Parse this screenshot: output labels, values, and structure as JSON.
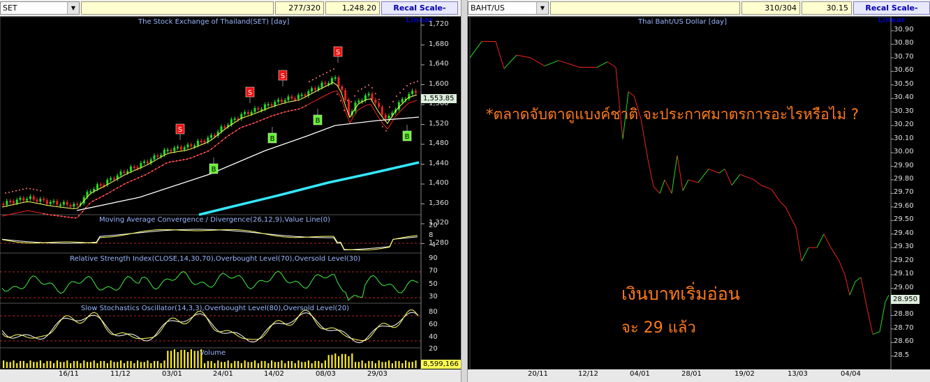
{
  "left": {
    "symbol": "SET",
    "bar_count": "277/320",
    "last_price": "1,248.20",
    "recal_label": "Recal Scale-Linear",
    "chart_title": "The Stock Exchange of Thailand(SET) [day]",
    "price_axis": [
      "1,720",
      "1,680",
      "1,640",
      "1,600",
      "1,560",
      "1,520",
      "1,480",
      "1,440",
      "1,400",
      "1,360",
      "1,320",
      "1,280"
    ],
    "current_price_label": "1,553.85",
    "macd_title": "Moving Average Convergence / Divergence(26,12,9),Value Line(0)",
    "macd_axis": [
      "20",
      "8",
      "-4"
    ],
    "rsi_title": "Relative Strength Index(CLOSE,14,30,70),Overbought Level(70),Oversold Level(30)",
    "rsi_axis": [
      "90",
      "70",
      "50",
      "30"
    ],
    "stoch_title": "Slow Stochastics Oscillator(14,3,3),Overbought Level(80),Oversold Level(20)",
    "stoch_axis": [
      "80",
      "60",
      "40",
      "20"
    ],
    "volume_title": "Volume",
    "volume_label": "8,599,166",
    "x_labels": [
      "16/11",
      "11/12",
      "03/01",
      "24/01",
      "14/02",
      "08/03",
      "29/03"
    ],
    "sell_signal": "S",
    "buy_signal": "B"
  },
  "right": {
    "symbol": "BAHT/US",
    "bar_count": "310/304",
    "last_price": "30.15",
    "recal_label": "Recal Scale-Linear",
    "chart_title": "Thai Baht/US Dollar [day]",
    "price_axis": [
      "30.90",
      "30.80",
      "30.70",
      "30.60",
      "30.50",
      "30.40",
      "30.30",
      "30.20",
      "30.10",
      "30.00",
      "29.90",
      "29.80",
      "29.70",
      "29.60",
      "29.50",
      "29.40",
      "29.30",
      "29.20",
      "29.10",
      "29.00",
      "28.90",
      "28.80",
      "28.70",
      "28.60",
      "28.5"
    ],
    "current_price_label": "28.950",
    "annotation_1": "*ตลาดจับตาดูแบงค์ชาติ จะประกาศมาตรการอะไรหรือไม่ ?",
    "annotation_2": "เงินบาทเริ่มอ่อน",
    "annotation_3": "จะ 29 แล้ว",
    "x_labels": [
      "20/11",
      "12/12",
      "04/01",
      "28/01",
      "19/02",
      "13/03",
      "04/04"
    ]
  },
  "colors": {
    "up": "#22dd22",
    "down": "#ee2222",
    "ma_white": "#ffffff",
    "ma_yellow": "#ffff66",
    "ma_red": "#ee2222",
    "ma_cyan": "#33e8ff",
    "title_blue": "#9ab8ff",
    "annotation_orange": "#ff7a1a"
  }
}
